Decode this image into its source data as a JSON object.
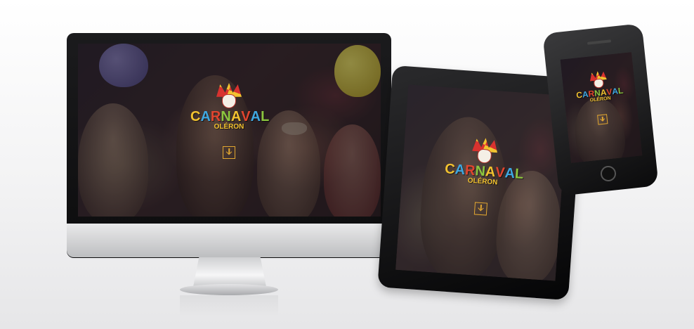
{
  "brand": {
    "title_letters": [
      "C",
      "A",
      "R",
      "N",
      "A",
      "V",
      "A",
      "L"
    ],
    "title_colors": [
      "#f2c230",
      "#3fa7e0",
      "#e0452f",
      "#8cc63f",
      "#f2c230",
      "#e0452f",
      "#3fa7e0",
      "#8cc63f"
    ],
    "subtitle": "OLÉRON",
    "jester_icon": "jester-mask-icon",
    "download_icon": "download-icon"
  },
  "devices": [
    "desktop-monitor",
    "tablet",
    "smartphone"
  ]
}
